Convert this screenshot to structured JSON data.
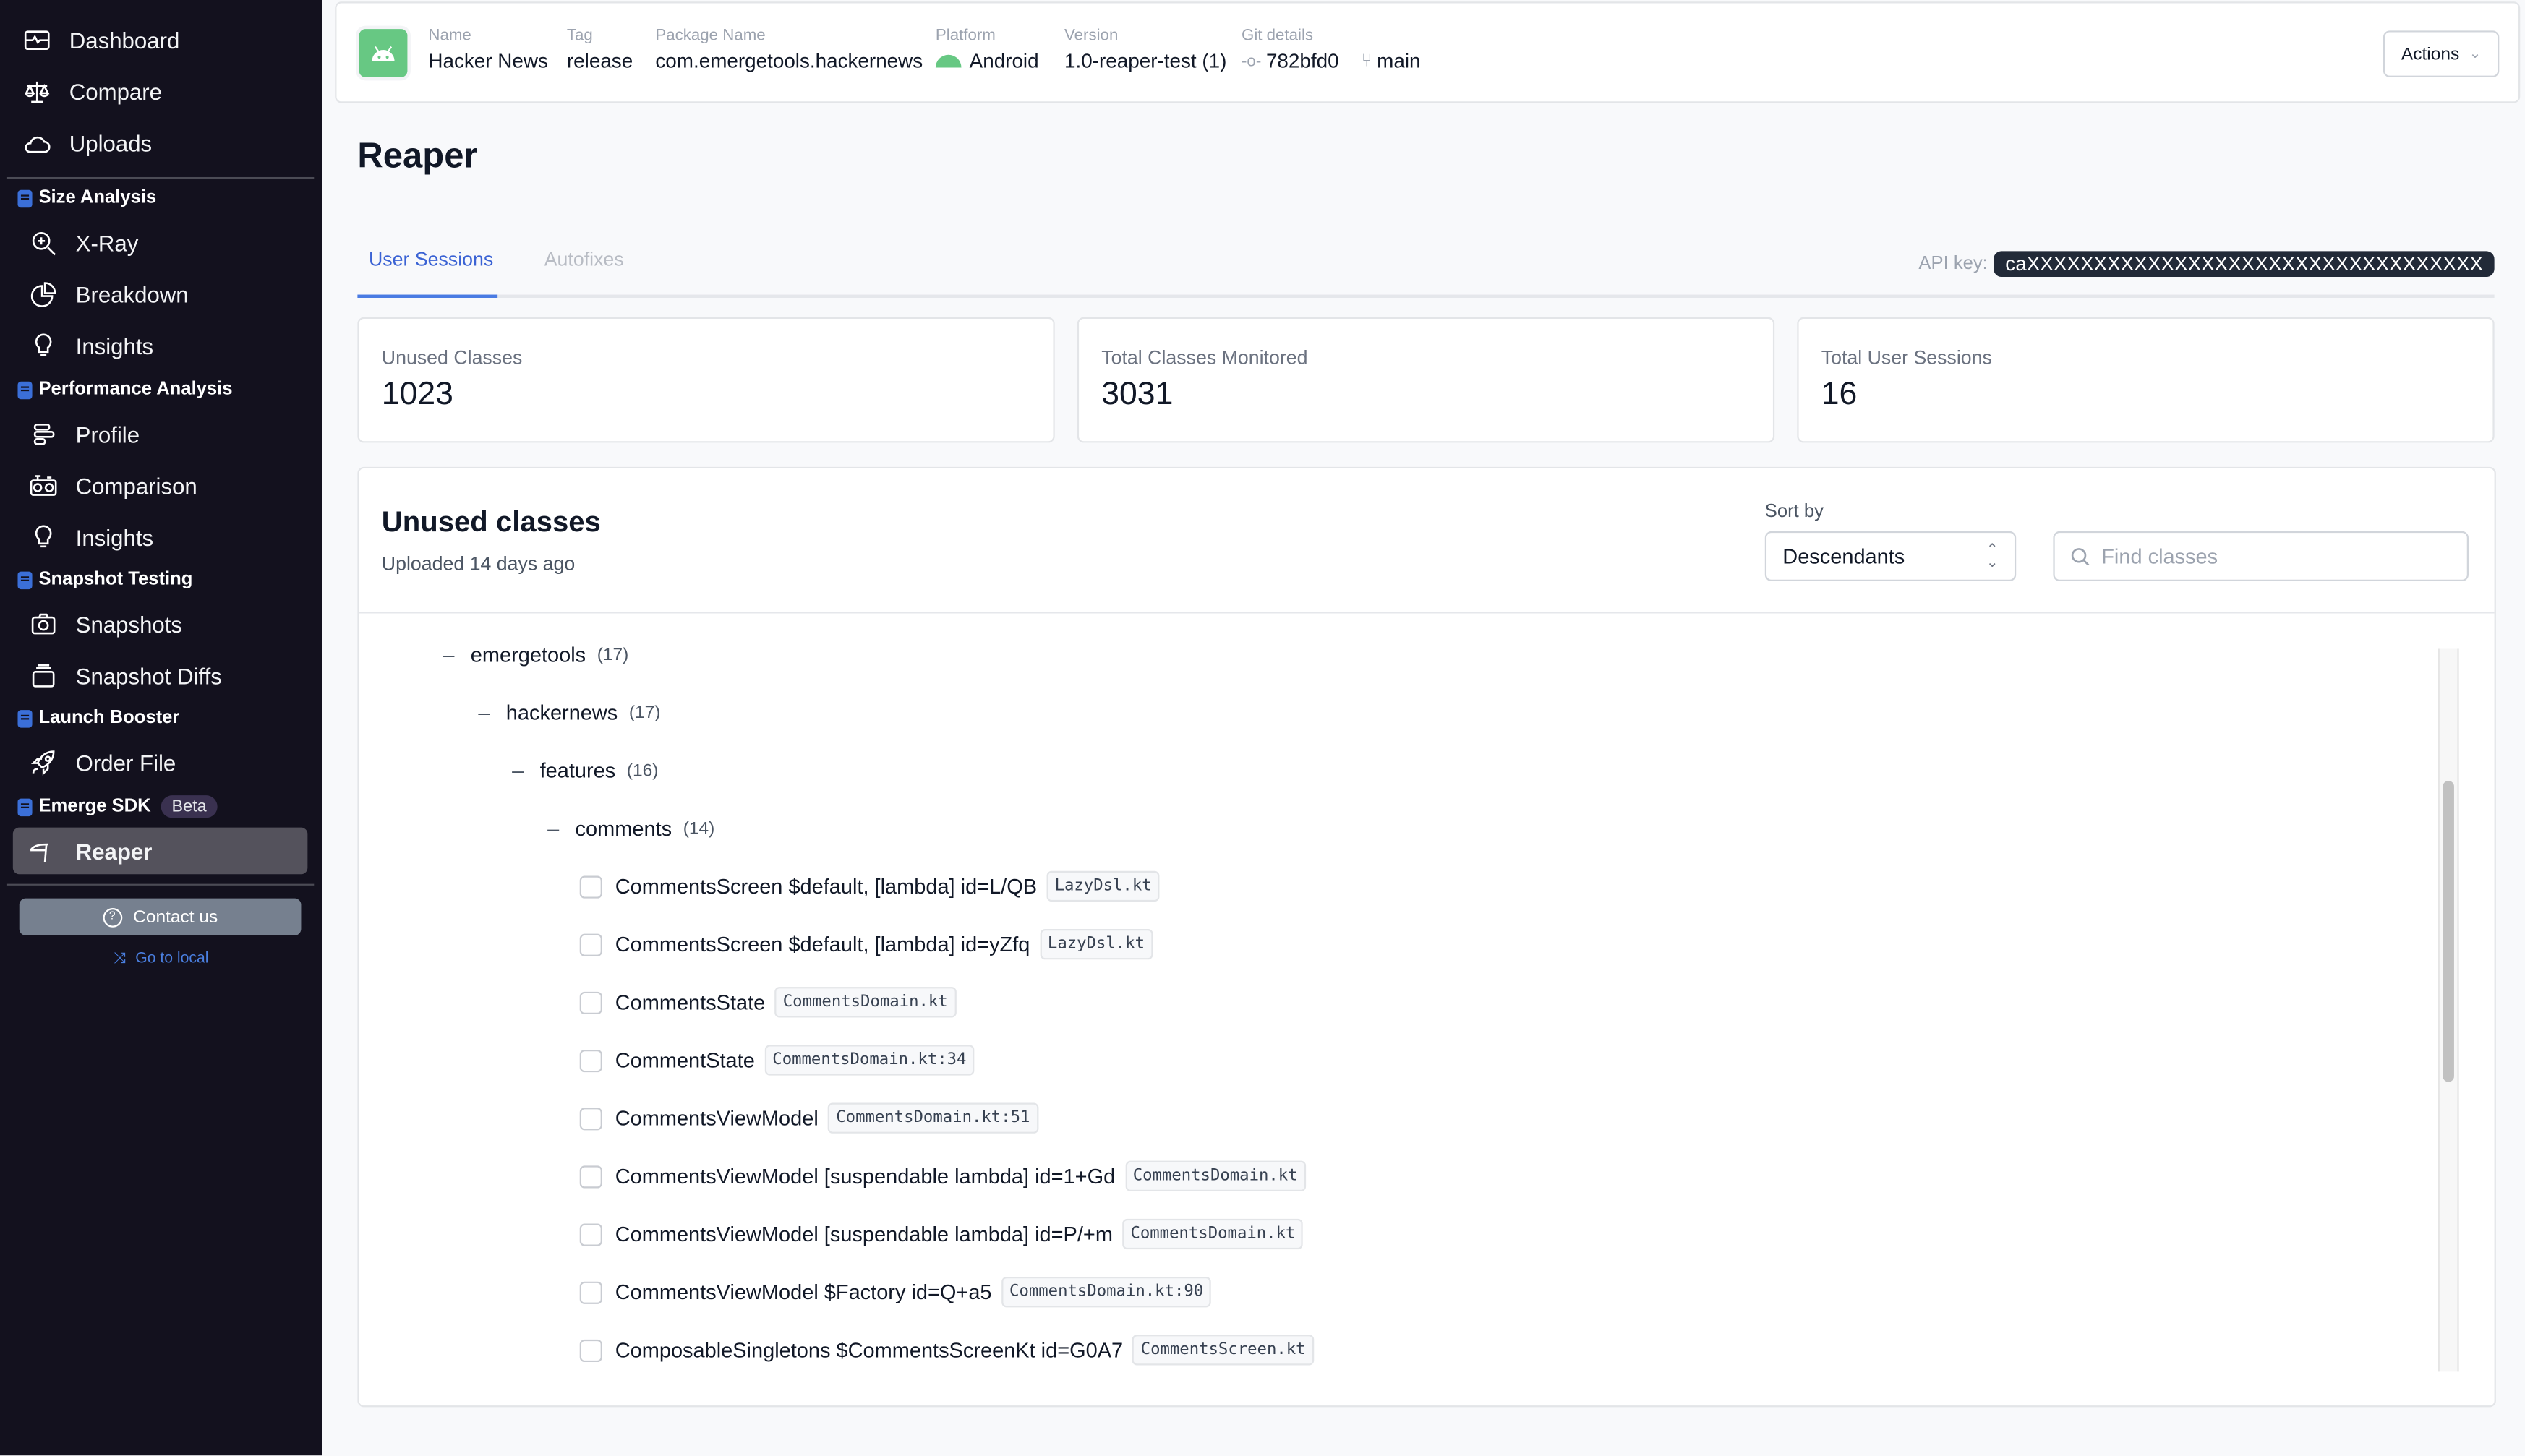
{
  "sidebar": {
    "top_items": [
      {
        "label": "Dashboard",
        "icon": "dashboard-icon"
      },
      {
        "label": "Compare",
        "icon": "scale-icon"
      },
      {
        "label": "Uploads",
        "icon": "cloud-icon"
      }
    ],
    "sections": [
      {
        "title": "Size Analysis",
        "items": [
          {
            "label": "X-Ray",
            "icon": "zoom-in-icon"
          },
          {
            "label": "Breakdown",
            "icon": "pie-chart-icon"
          },
          {
            "label": "Insights",
            "icon": "lightbulb-icon"
          }
        ]
      },
      {
        "title": "Performance Analysis",
        "items": [
          {
            "label": "Profile",
            "icon": "profile-bars-icon"
          },
          {
            "label": "Comparison",
            "icon": "stopwatch-pair-icon"
          },
          {
            "label": "Insights",
            "icon": "lightbulb-icon"
          }
        ]
      },
      {
        "title": "Snapshot Testing",
        "items": [
          {
            "label": "Snapshots",
            "icon": "camera-icon"
          },
          {
            "label": "Snapshot Diffs",
            "icon": "stack-icon"
          }
        ]
      },
      {
        "title": "Launch Booster",
        "items": [
          {
            "label": "Order File",
            "icon": "rocket-icon"
          }
        ]
      },
      {
        "title": "Emerge SDK",
        "badge": "Beta",
        "items": [
          {
            "label": "Reaper",
            "icon": "scythe-icon",
            "active": true
          }
        ]
      }
    ],
    "contact_label": "Contact us",
    "local_label": "Go to local"
  },
  "header": {
    "name_label": "Name",
    "name": "Hacker News",
    "tag_label": "Tag",
    "tag": "release",
    "package_label": "Package Name",
    "package": "com.emergetools.hackernews",
    "platform_label": "Platform",
    "platform": "Android",
    "version_label": "Version",
    "version": "1.0-reaper-test (1)",
    "git_label": "Git details",
    "commit": "782bfd0",
    "branch": "main",
    "actions_label": "Actions"
  },
  "page": {
    "title": "Reaper",
    "tabs": [
      {
        "label": "User Sessions",
        "active": true
      },
      {
        "label": "Autofixes",
        "active": false
      }
    ],
    "api_key_label": "API key:",
    "api_key": "caXXXXXXXXXXXXXXXXXXXXXXXXXXXXXXXXXX"
  },
  "stats": [
    {
      "label": "Unused Classes",
      "value": "1023"
    },
    {
      "label": "Total Classes Monitored",
      "value": "3031"
    },
    {
      "label": "Total User Sessions",
      "value": "16"
    }
  ],
  "panel": {
    "title": "Unused classes",
    "subtitle": "Uploaded 14 days ago",
    "sort_label": "Sort by",
    "sort_value": "Descendants",
    "search_placeholder": "Find classes",
    "search_value": "",
    "tree": [
      {
        "name": "emergetools",
        "count": "(17)"
      },
      {
        "name": "hackernews",
        "count": "(17)"
      },
      {
        "name": "features",
        "count": "(16)"
      },
      {
        "name": "comments",
        "count": "(14)"
      }
    ],
    "classes": [
      {
        "name": "CommentsScreen $default, [lambda] id=L/QB",
        "file": "LazyDsl.kt"
      },
      {
        "name": "CommentsScreen $default, [lambda] id=yZfq",
        "file": "LazyDsl.kt"
      },
      {
        "name": "CommentsState",
        "file": "CommentsDomain.kt"
      },
      {
        "name": "CommentState",
        "file": "CommentsDomain.kt:34"
      },
      {
        "name": "CommentsViewModel",
        "file": "CommentsDomain.kt:51"
      },
      {
        "name": "CommentsViewModel [suspendable lambda] id=1+Gd",
        "file": "CommentsDomain.kt"
      },
      {
        "name": "CommentsViewModel [suspendable lambda] id=P/+m",
        "file": "CommentsDomain.kt"
      },
      {
        "name": "CommentsViewModel $Factory id=Q+a5",
        "file": "CommentsDomain.kt:90"
      },
      {
        "name": "ComposableSingletons $CommentsScreenKt id=G0A7",
        "file": "CommentsScreen.kt"
      }
    ]
  }
}
